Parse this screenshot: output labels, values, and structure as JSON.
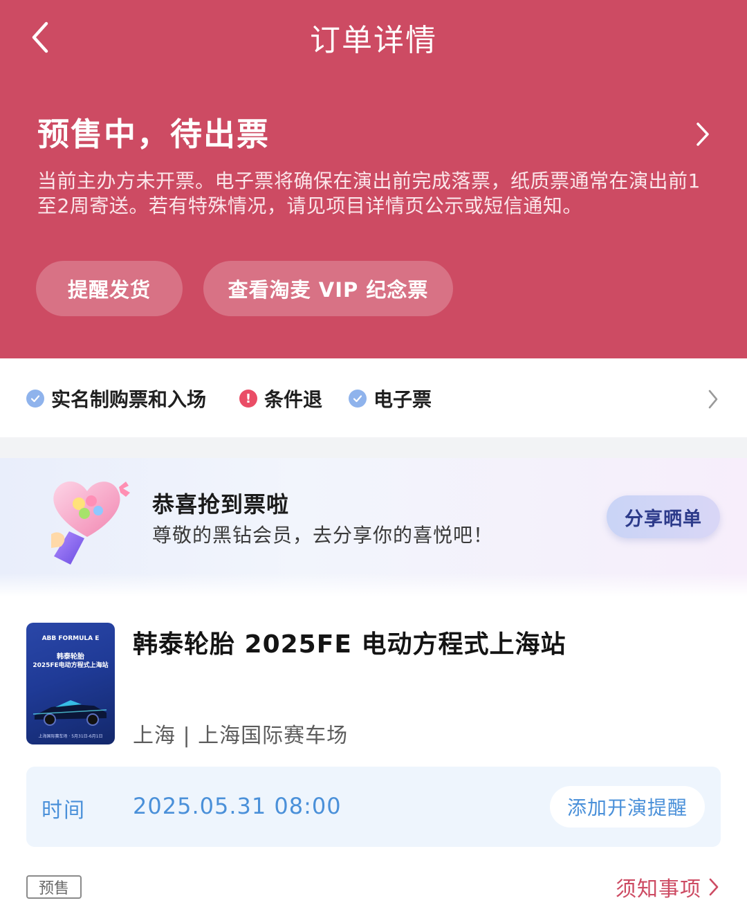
{
  "nav": {
    "title": "订单详情",
    "back_icon": "chevron-left-icon"
  },
  "status": {
    "title": "预售中，待出票",
    "description": "当前主办方未开票。电子票将确保在演出前完成落票，纸质票通常在演出前1至2周寄送。若有特殊情况，请见项目详情页公示或短信通知。",
    "buttons": [
      {
        "label": "提醒发货"
      },
      {
        "label": "查看淘麦 VIP 纪念票"
      }
    ]
  },
  "features": {
    "items": [
      {
        "label": "实名制购票和入场",
        "icon": "check-circle-icon"
      },
      {
        "label": "条件退",
        "icon": "warning-circle-icon"
      },
      {
        "label": "电子票",
        "icon": "check-circle-icon"
      }
    ]
  },
  "banner": {
    "title": "恭喜抢到票啦",
    "subtitle": "尊敬的黑钻会员，去分享你的喜悦吧！",
    "share_label": "分享晒单",
    "art_icon": "light-stick-icon"
  },
  "event": {
    "title": "韩泰轮胎 2025FE 电动方程式上海站",
    "venue": "上海 | 上海国际赛车场",
    "poster": {
      "brand": "ABB FORMULA E",
      "line1": "韩泰轮胎",
      "line2": "2025FE电动方程式上海站",
      "footer": "上海国际赛车场 · 5月31日-6月1日"
    },
    "time_label": "时间",
    "time_value": "2025.05.31 08:00",
    "reminder_label": "添加开演提醒",
    "tag": "预售",
    "notice_label": "须知事项"
  },
  "colors": {
    "brand": "#cd4b63",
    "accent_blue": "#4a90d9",
    "check_icon": "#8fb3ec",
    "warn_icon": "#ea4d66"
  }
}
